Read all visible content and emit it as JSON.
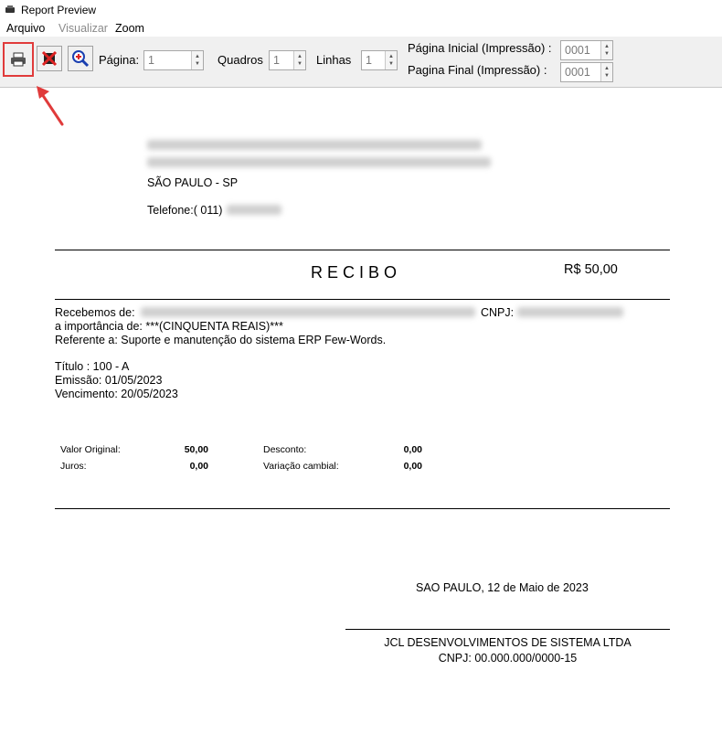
{
  "window": {
    "title": "Report Preview"
  },
  "menu": {
    "items": [
      "Arquivo",
      "Visualizar",
      "Zoom"
    ]
  },
  "toolbar": {
    "pagina_label": "Página:",
    "pagina_value": "1",
    "quadros_label": "Quadros",
    "quadros_value": "1",
    "linhas_label": "Linhas",
    "linhas_value": "1",
    "pagina_inicial_label": "Página Inicial (Impressão) :",
    "pagina_inicial_value": "0001",
    "pagina_final_label": "Pagina Final (Impressão) :",
    "pagina_final_value": "0001"
  },
  "report": {
    "city_state": "SÃO PAULO - SP",
    "phone_prefix": "Telefone:( 011)",
    "title": "R E C I B O",
    "amount": "R$ 50,00",
    "received_from_label": "Recebemos de:",
    "cnpj_label": "CNPJ:",
    "importance_line": "a importância de: ***(CINQUENTA REAIS)***",
    "reference_line": "Referente a: Suporte e manutenção do sistema ERP Few-Words.",
    "titulo_line": "Título : 100 - A",
    "emissao_line": "Emissão: 01/05/2023",
    "vencimento_line": "Vencimento: 20/05/2023",
    "valor_original_label": "Valor Original:",
    "valor_original_value": "50,00",
    "juros_label": "Juros:",
    "juros_value": "0,00",
    "desconto_label": "Desconto:",
    "desconto_value": "0,00",
    "variacao_label": "Variação cambial:",
    "variacao_value": "0,00",
    "place_date": "SAO PAULO, 12 de Maio de 2023",
    "company_name": "JCL DESENVOLVIMENTOS DE SISTEMA LTDA",
    "company_cnpj": "CNPJ: 00.000.000/0000-15"
  },
  "icons": [
    "app-icon",
    "print-icon",
    "close-icon",
    "zoom-in-icon",
    "annotation-arrow-icon"
  ],
  "colors": {
    "highlight": "#e03b3b",
    "toolbar_bg": "#f0f0f0"
  }
}
